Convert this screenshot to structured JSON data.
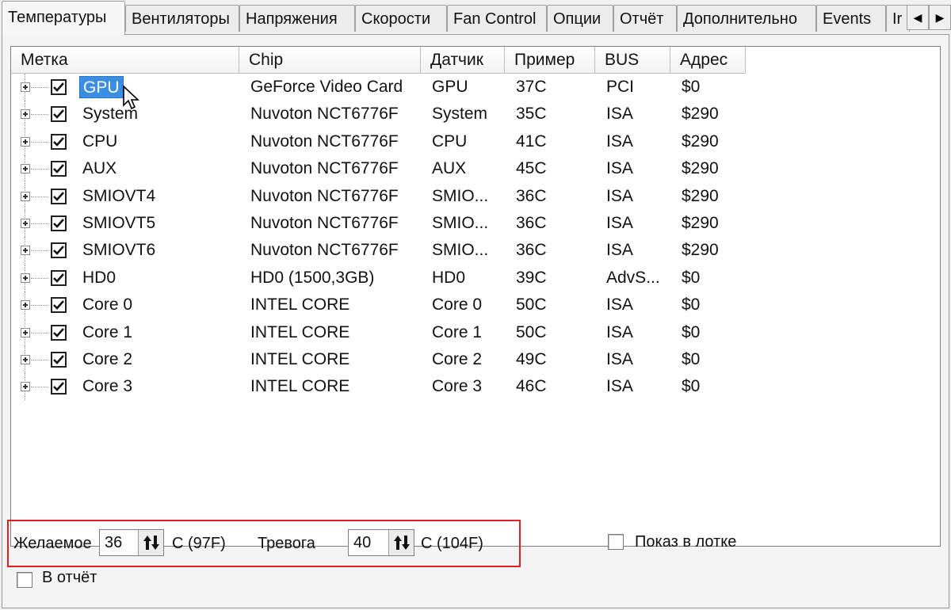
{
  "tabs": [
    {
      "label": "Температуры",
      "active": true
    },
    {
      "label": "Вентиляторы"
    },
    {
      "label": "Напряжения"
    },
    {
      "label": "Скорости"
    },
    {
      "label": "Fan Control"
    },
    {
      "label": "Опции"
    },
    {
      "label": "Отчёт"
    },
    {
      "label": "Дополнительно"
    },
    {
      "label": "Events"
    },
    {
      "label": "Ir"
    }
  ],
  "tab_scroll": {
    "left": "◀",
    "right": "▶"
  },
  "columns": [
    "Метка",
    "Chip",
    "Датчик",
    "Пример",
    "BUS",
    "Адрес"
  ],
  "rows": [
    {
      "label": "GPU",
      "chip": "GeForce Video Card",
      "sensor": "GPU",
      "sample": "37C",
      "bus": "PCI",
      "addr": "$0",
      "checked": true,
      "selected": true
    },
    {
      "label": "System",
      "chip": "Nuvoton NCT6776F",
      "sensor": "System",
      "sample": "35C",
      "bus": "ISA",
      "addr": "$290",
      "checked": true
    },
    {
      "label": "CPU",
      "chip": "Nuvoton NCT6776F",
      "sensor": "CPU",
      "sample": "41C",
      "bus": "ISA",
      "addr": "$290",
      "checked": true
    },
    {
      "label": "AUX",
      "chip": "Nuvoton NCT6776F",
      "sensor": "AUX",
      "sample": "45C",
      "bus": "ISA",
      "addr": "$290",
      "checked": true
    },
    {
      "label": "SMIOVT4",
      "chip": "Nuvoton NCT6776F",
      "sensor": "SMIO...",
      "sample": "36C",
      "bus": "ISA",
      "addr": "$290",
      "checked": true
    },
    {
      "label": "SMIOVT5",
      "chip": "Nuvoton NCT6776F",
      "sensor": "SMIO...",
      "sample": "36C",
      "bus": "ISA",
      "addr": "$290",
      "checked": true
    },
    {
      "label": "SMIOVT6",
      "chip": "Nuvoton NCT6776F",
      "sensor": "SMIO...",
      "sample": "36C",
      "bus": "ISA",
      "addr": "$290",
      "checked": true
    },
    {
      "label": "HD0",
      "chip": "HD0 (1500,3GB)",
      "sensor": "HD0",
      "sample": "39C",
      "bus": "AdvS...",
      "addr": "$0",
      "checked": true
    },
    {
      "label": "Core 0",
      "chip": "INTEL CORE",
      "sensor": "Core 0",
      "sample": "50C",
      "bus": "ISA",
      "addr": "$0",
      "checked": true
    },
    {
      "label": "Core 1",
      "chip": "INTEL CORE",
      "sensor": "Core 1",
      "sample": "50C",
      "bus": "ISA",
      "addr": "$0",
      "checked": true
    },
    {
      "label": "Core 2",
      "chip": "INTEL CORE",
      "sensor": "Core 2",
      "sample": "49C",
      "bus": "ISA",
      "addr": "$0",
      "checked": true
    },
    {
      "label": "Core 3",
      "chip": "INTEL CORE",
      "sensor": "Core 3",
      "sample": "46C",
      "bus": "ISA",
      "addr": "$0",
      "checked": true
    }
  ],
  "controls": {
    "desired_label": "Желаемое",
    "desired_value": "36",
    "desired_unit": "C (97F)",
    "alarm_label": "Тревога",
    "alarm_value": "40",
    "alarm_unit": "C (104F)",
    "show_in_tray_label": "Показ в лотке",
    "in_report_label": "В отчёт"
  },
  "colors": {
    "selection": "#3a8ee6",
    "highlight_box": "#e02020"
  }
}
